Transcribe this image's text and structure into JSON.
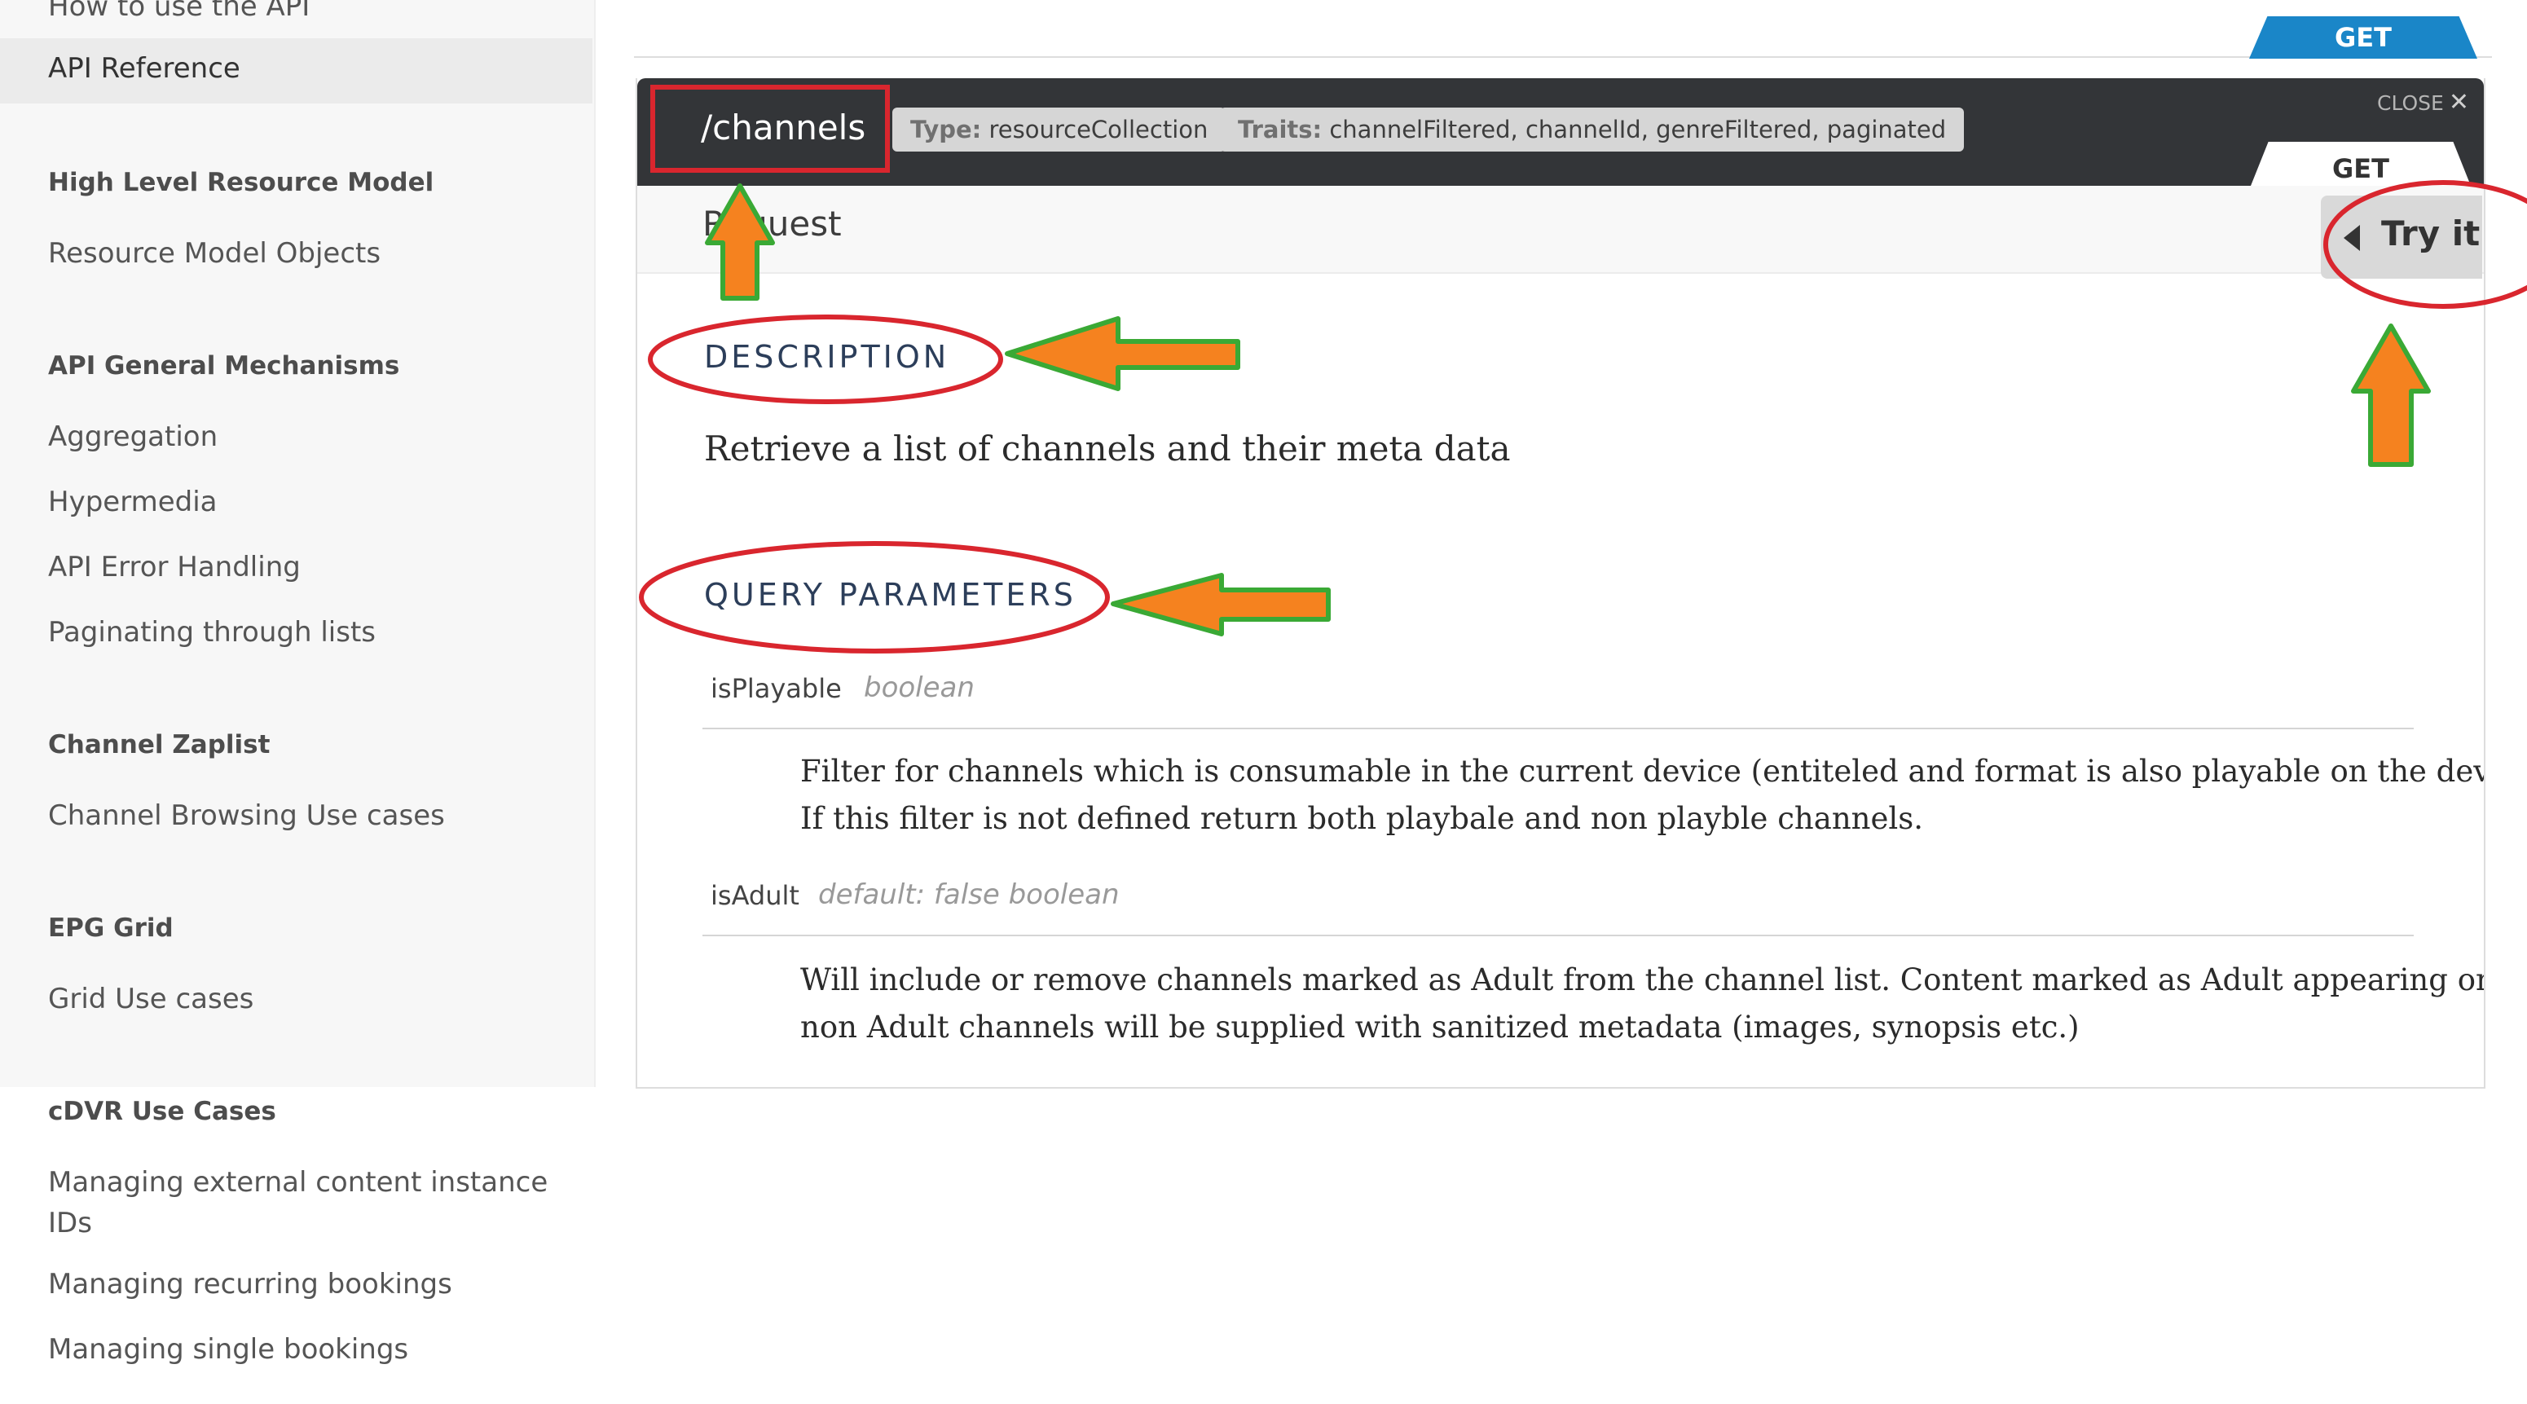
{
  "sidebar": {
    "items": [
      {
        "kind": "link",
        "label": "How to use the API"
      },
      {
        "kind": "link",
        "label": "API Reference",
        "active": true
      },
      {
        "kind": "heading",
        "label": "High Level Resource Model"
      },
      {
        "kind": "link",
        "label": "Resource Model Objects"
      },
      {
        "kind": "heading",
        "label": "API General Mechanisms"
      },
      {
        "kind": "link",
        "label": "Aggregation"
      },
      {
        "kind": "link",
        "label": "Hypermedia"
      },
      {
        "kind": "link",
        "label": "API Error Handling"
      },
      {
        "kind": "link",
        "label": "Paginating through lists"
      },
      {
        "kind": "heading",
        "label": "Channel Zaplist"
      },
      {
        "kind": "link",
        "label": "Channel Browsing Use cases"
      },
      {
        "kind": "heading",
        "label": "EPG Grid"
      },
      {
        "kind": "link",
        "label": "Grid Use cases"
      },
      {
        "kind": "heading",
        "label": "cDVR Use Cases"
      },
      {
        "kind": "link",
        "label": "Managing external content instance"
      },
      {
        "kind": "link",
        "label": "IDs"
      },
      {
        "kind": "link",
        "label": "Managing recurring bookings"
      },
      {
        "kind": "link",
        "label": "Managing single bookings"
      }
    ]
  },
  "method": {
    "top_tab": "GET",
    "panel_tab": "GET"
  },
  "resource": {
    "name": "/channels",
    "type_label": "Type:",
    "type_value": "resourceCollection",
    "traits_label": "Traits:",
    "traits_value": "channelFiltered, channelId, genreFiltered, paginated",
    "close_label": "CLOSE"
  },
  "request": {
    "label": "Request",
    "try_label": "Try it"
  },
  "description": {
    "title": "DESCRIPTION",
    "text": "Retrieve a list of channels and their meta data"
  },
  "query": {
    "title": "QUERY PARAMETERS",
    "params": [
      {
        "name": "isPlayable",
        "meta": "boolean",
        "desc_line1": "Filter for channels which is consumable in the current device (entiteled and format is also playable on the device).",
        "desc_line2": "If this filter is not defined return both playbale and non playble channels."
      },
      {
        "name": "isAdult",
        "meta": "default: false  boolean",
        "desc_line1": "Will include or remove channels marked as Adult from the channel list. Content marked as Adult appearing on",
        "desc_line2": "non Adult channels will be supplied with sanitized metadata (images, synopsis etc.)"
      }
    ]
  },
  "annotations": {
    "box_color": "#d9262e",
    "arrow_fill": "#f5821f",
    "arrow_stroke": "#3aa935"
  }
}
